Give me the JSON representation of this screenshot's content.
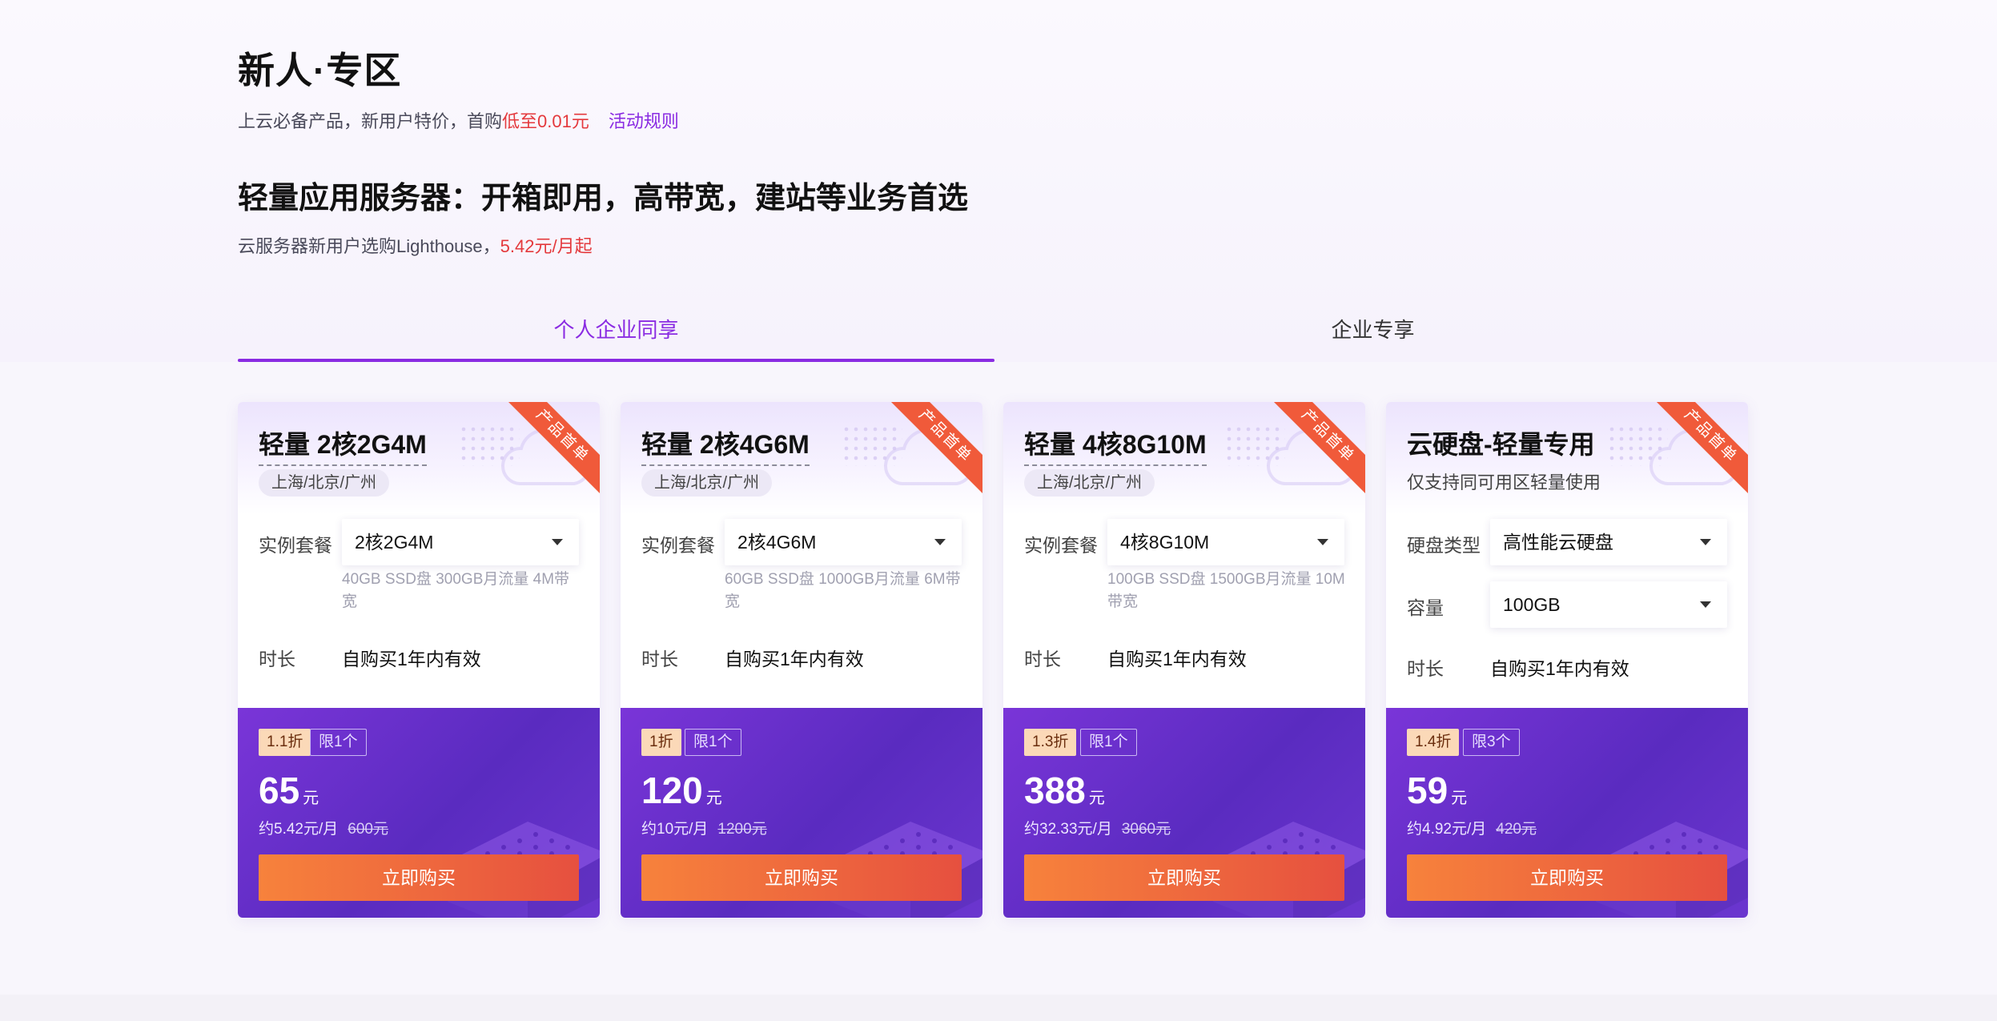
{
  "header": {
    "title": "新人·专区",
    "subtitle_prefix": "上云必备产品，新用户特价，首购",
    "subtitle_highlight": "低至0.01元",
    "rules_link": "活动规则"
  },
  "section": {
    "title": "轻量应用服务器：开箱即用，高带宽，建站等业务首选",
    "subtitle_prefix": "云服务器新用户选购Lighthouse，",
    "subtitle_highlight": "5.42元/月起"
  },
  "tabs": [
    {
      "label": "个人企业同享",
      "active": true
    },
    {
      "label": "企业专享",
      "active": false
    }
  ],
  "colors": {
    "accent": "#8a2be2",
    "price_red": "#e4393c",
    "ribbon": "#f05a3a",
    "footer_purple": "#6a32cc",
    "buy_button_start": "#f7823c",
    "buy_button_end": "#e6503f"
  },
  "cards": [
    {
      "ribbon": "产品首单",
      "title": "轻量 2核2G4M",
      "region": "上海/北京/广州",
      "package_label": "实例套餐",
      "package_value": "2核2G4M",
      "spec": "40GB SSD盘 300GB月流量 4M带宽",
      "duration_label": "时长",
      "duration_value": "自购买1年内有效",
      "discount": "1.1折",
      "limit": "限1个",
      "price": "65",
      "price_unit": "元",
      "monthly": "约5.42元/月",
      "original": "600元",
      "buy_label": "立即购买"
    },
    {
      "ribbon": "产品首单",
      "title": "轻量 2核4G6M",
      "region": "上海/北京/广州",
      "package_label": "实例套餐",
      "package_value": "2核4G6M",
      "spec": "60GB SSD盘 1000GB月流量 6M带宽",
      "duration_label": "时长",
      "duration_value": "自购买1年内有效",
      "discount": "1折",
      "limit": "限1个",
      "price": "120",
      "price_unit": "元",
      "monthly": "约10元/月",
      "original": "1200元",
      "buy_label": "立即购买"
    },
    {
      "ribbon": "产品首单",
      "title": "轻量 4核8G10M",
      "region": "上海/北京/广州",
      "package_label": "实例套餐",
      "package_value": "4核8G10M",
      "spec": "100GB SSD盘 1500GB月流量 10M带宽",
      "duration_label": "时长",
      "duration_value": "自购买1年内有效",
      "discount": "1.3折",
      "limit": "限1个",
      "price": "388",
      "price_unit": "元",
      "monthly": "约32.33元/月",
      "original": "3060元",
      "buy_label": "立即购买"
    },
    {
      "ribbon": "产品首单",
      "title": "云硬盘-轻量专用",
      "desc": "仅支持同可用区轻量使用",
      "disk_type_label": "硬盘类型",
      "disk_type_value": "高性能云硬盘",
      "capacity_label": "容量",
      "capacity_value": "100GB",
      "duration_label": "时长",
      "duration_value": "自购买1年内有效",
      "discount": "1.4折",
      "limit": "限3个",
      "price": "59",
      "price_unit": "元",
      "monthly": "约4.92元/月",
      "original": "420元",
      "buy_label": "立即购买"
    }
  ]
}
